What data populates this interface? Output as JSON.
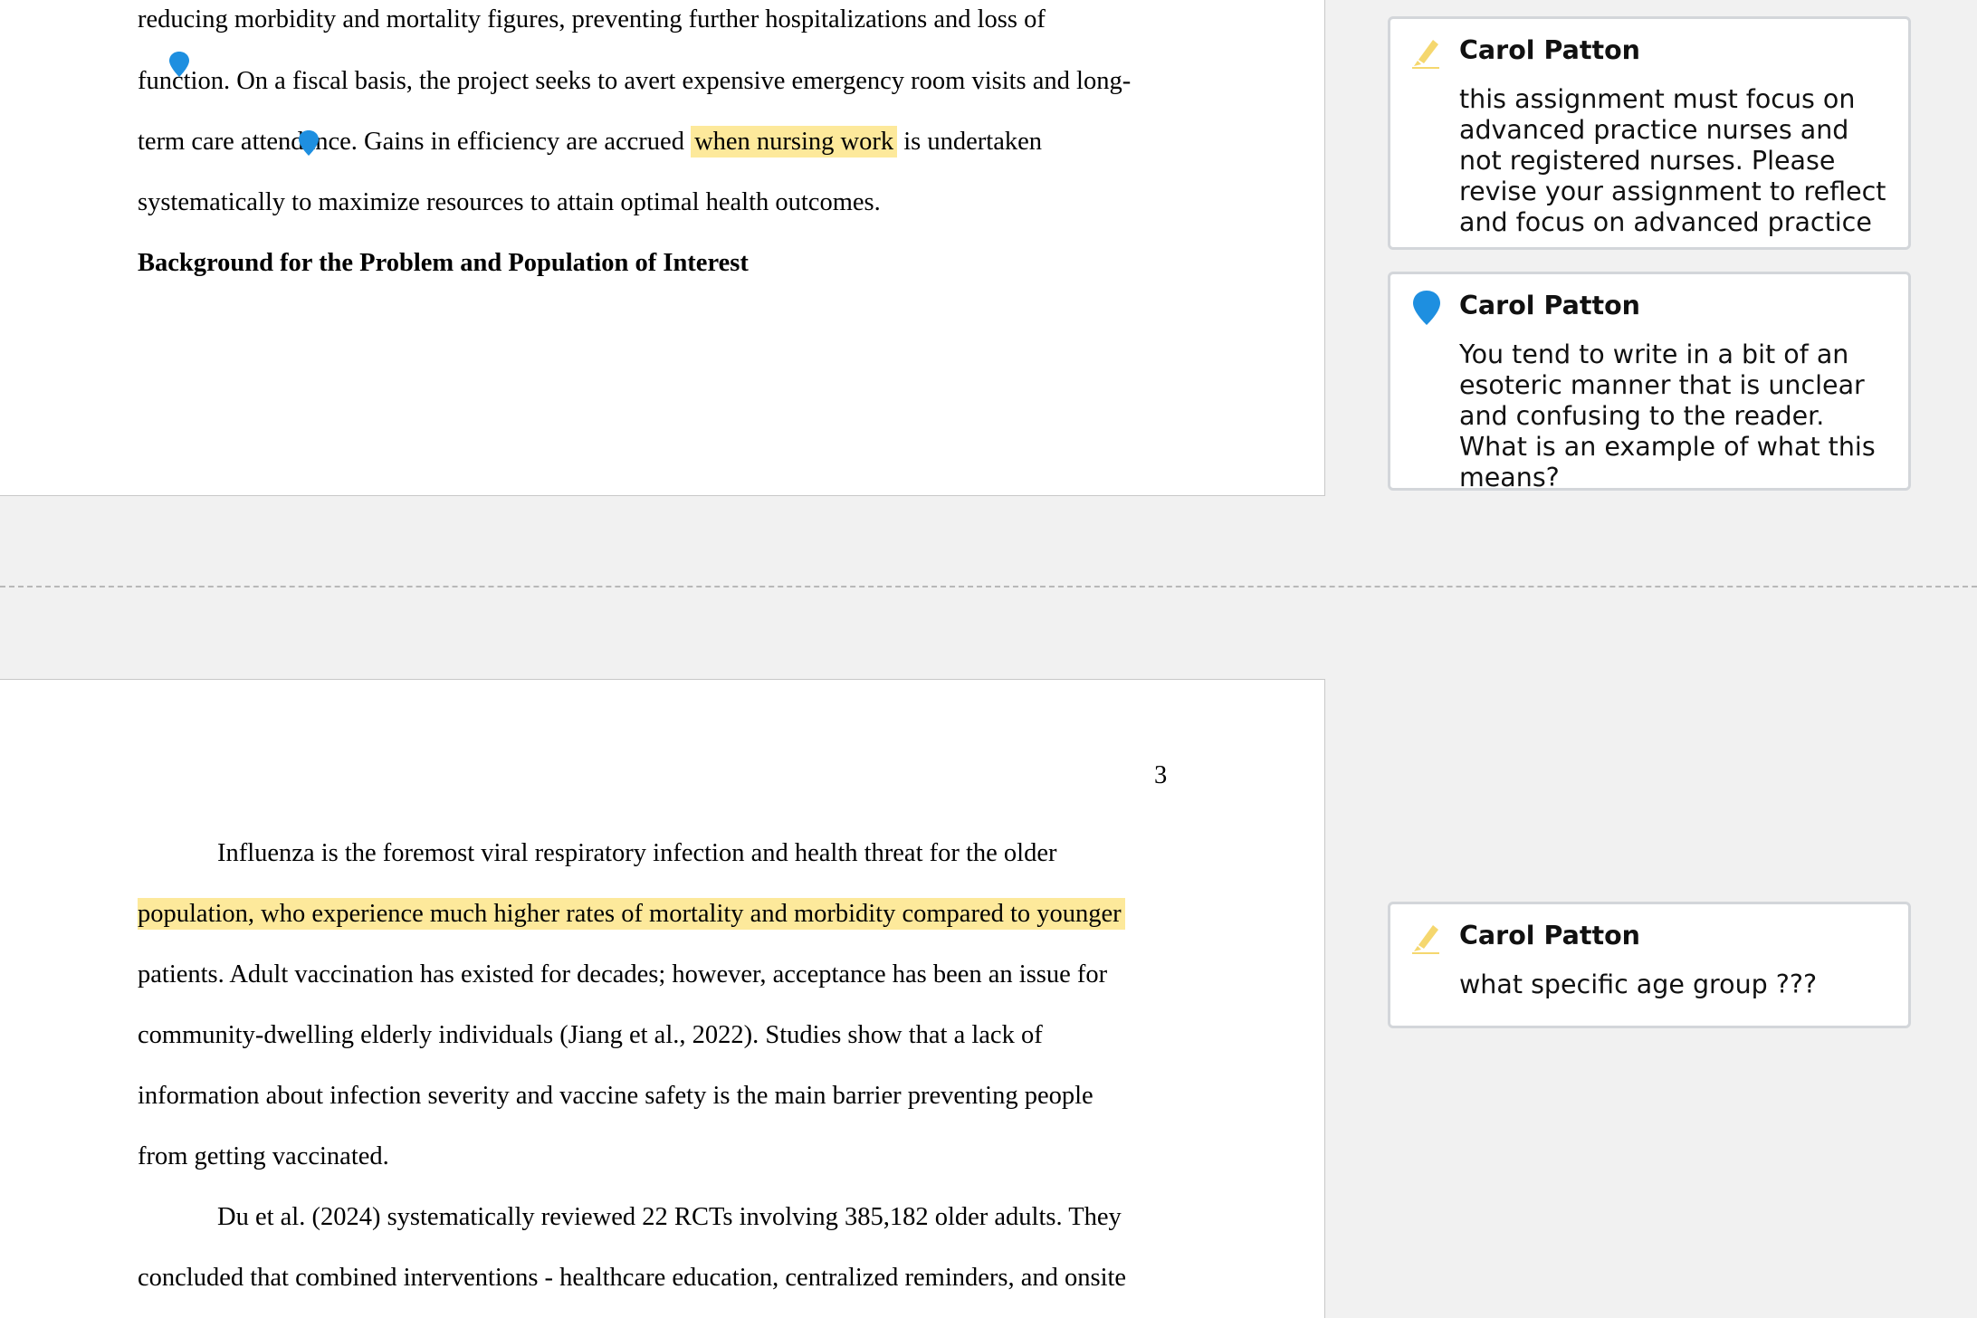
{
  "document": {
    "page1": {
      "lines": [
        "reducing morbidity and mortality figures, preventing further hospitalizations and loss of",
        "function. On a fiscal basis, the project seeks to avert expensive emergency room visits and long-",
        "systematically to maximize resources to attain optimal health outcomes."
      ],
      "line3_before": "term care attendance. Gains in efficiency are accrued ",
      "line3_highlight": "when nursing work",
      "line3_after": " is undertaken",
      "heading": "Background for the Problem and Population of Interest"
    },
    "page2": {
      "page_number": "3",
      "p1_line1": "Influenza is the foremost viral respiratory infection and health threat for the older",
      "p1_line2_highlight": "population, who experience much higher rates of mortality and morbidity compared to younger",
      "p1_line3": "patients. Adult vaccination has existed for decades; however, acceptance has been an issue for",
      "p1_line4": "community-dwelling elderly individuals (Jiang et al., 2022). Studies show that a lack of",
      "p1_line5": "information about infection severity and vaccine safety is the main barrier preventing people",
      "p1_line6": "from getting vaccinated.",
      "p2_line1": "Du et al. (2024) systematically reviewed 22 RCTs involving 385,182 older adults. They",
      "p2_line2": "concluded that combined interventions - healthcare education, centralized reminders, and onsite"
    }
  },
  "comments": [
    {
      "icon": "highlighter-icon",
      "author": "Carol Patton",
      "text": "this assignment must focus on advanced practice nurses  and not registered nurses. Please revise your assignment to reflect and focus on advanced practice nurses-famiklv",
      "more": "[...]"
    },
    {
      "icon": "pin-icon",
      "author": "Carol Patton",
      "text": "You tend to write in a bit of an esoteric manner that is unclear and confusing to the reader. What is an example of what this means?"
    },
    {
      "icon": "highlighter-icon",
      "author": "Carol Patton",
      "text": "what specific age group ???"
    }
  ],
  "colors": {
    "highlight": "#fde99b",
    "pin": "#1e8fe0",
    "highlighter": "#f5d76e",
    "more_link": "#2b8fd8"
  }
}
